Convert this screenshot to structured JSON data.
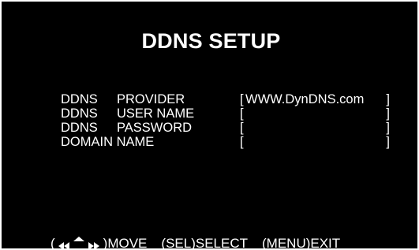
{
  "title": "DDNS SETUP",
  "fields": [
    {
      "label_a": "DDNS",
      "label_b": "PROVIDER",
      "value": "WWW.DynDNS.com "
    },
    {
      "label_a": "DDNS",
      "label_b": "USER NAME",
      "value": ""
    },
    {
      "label_a": "DDNS",
      "label_b": "PASSWORD",
      "value": ""
    },
    {
      "label_a": "DOMAIN NAME",
      "label_b": "",
      "value": ""
    }
  ],
  "help": {
    "open_paren": "(",
    "arrows_icon": "arrows-left-up-right-icon",
    "move": ")MOVE",
    "select": "(SEL)SELECT",
    "exit": "(MENU)EXIT"
  },
  "colors": {
    "background": "#000000",
    "text": "#ffffff"
  }
}
